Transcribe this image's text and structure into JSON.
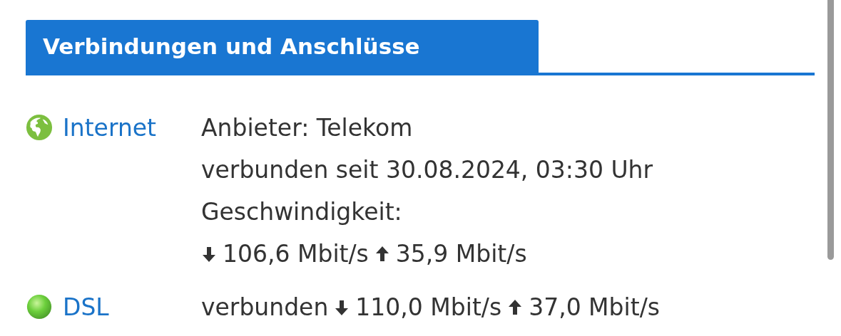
{
  "section": {
    "title": "Verbindungen und Anschlüsse"
  },
  "connections": [
    {
      "name": "Internet",
      "kind": "globe",
      "lines": [
        {
          "text": "Anbieter: Telekom"
        },
        {
          "text": "verbunden seit 30.08.2024, 03:30 Uhr"
        },
        {
          "text": "Geschwindigkeit:"
        },
        {
          "down": "106,6 Mbit/s",
          "up": "35,9 Mbit/s"
        }
      ]
    },
    {
      "name": "DSL",
      "kind": "led",
      "lines": [
        {
          "text": "verbunden",
          "down": "110,0 Mbit/s",
          "up": "37,0 Mbit/s"
        }
      ]
    }
  ]
}
